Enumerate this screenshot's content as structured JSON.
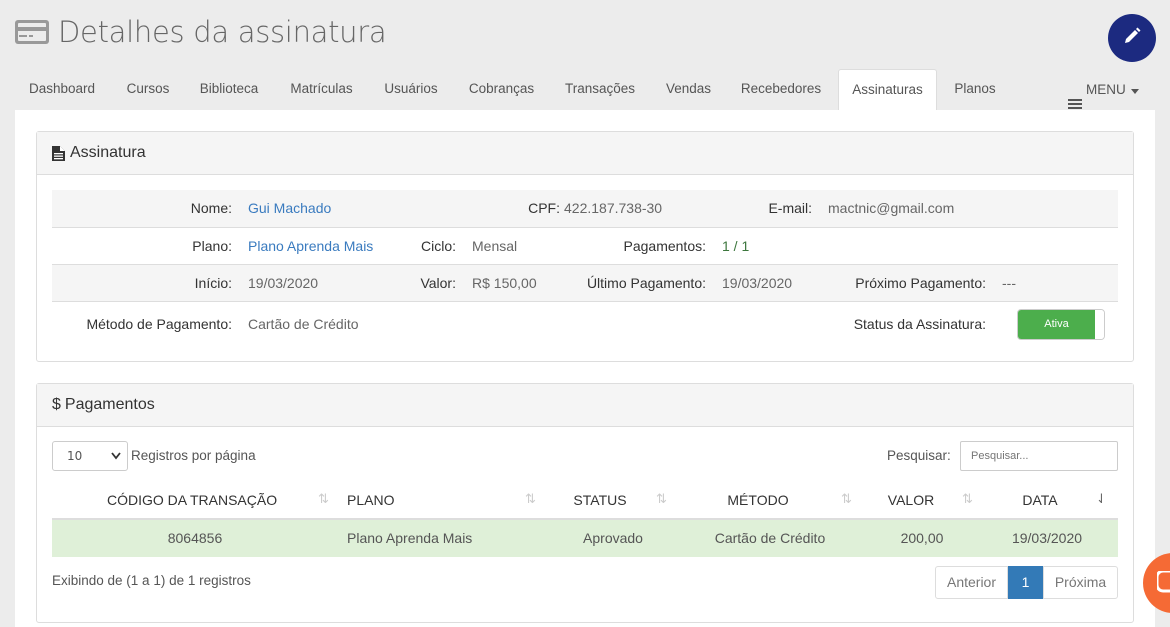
{
  "header": {
    "title": "Detalhes da assinatura"
  },
  "nav": {
    "tabs": [
      {
        "label": "Dashboard"
      },
      {
        "label": "Cursos"
      },
      {
        "label": "Biblioteca"
      },
      {
        "label": "Matrículas"
      },
      {
        "label": "Usuários"
      },
      {
        "label": "Cobranças"
      },
      {
        "label": "Transações"
      },
      {
        "label": "Vendas"
      },
      {
        "label": "Recebedores"
      },
      {
        "label": "Assinaturas"
      },
      {
        "label": "Planos"
      }
    ],
    "active_tab": "Assinaturas",
    "menu_label": "MENU"
  },
  "subscription": {
    "heading": "Assinatura",
    "nome_label": "Nome:",
    "nome": "Gui Machado",
    "cpf_label": "CPF:",
    "cpf": "422.187.738-30",
    "email_label": "E-mail:",
    "email": "mactnic@gmail.com",
    "plano_label": "Plano:",
    "plano": "Plano Aprenda Mais",
    "ciclo_label": "Ciclo:",
    "ciclo": "Mensal",
    "pagamentos_label": "Pagamentos:",
    "pagamentos": "1 / 1",
    "inicio_label": "Início:",
    "inicio": "19/03/2020",
    "valor_label": "Valor:",
    "valor": "R$ 150,00",
    "ultimo_label": "Último Pagamento:",
    "ultimo": "19/03/2020",
    "proximo_label": "Próximo Pagamento:",
    "proximo": "---",
    "metodo_label": "Método de Pagamento:",
    "metodo": "Cartão de Crédito",
    "status_label": "Status da Assinatura:",
    "status_toggle": "Ativa"
  },
  "payments": {
    "heading": "Pagamentos",
    "page_size": "10",
    "page_size_label": "Registros por página",
    "search_label": "Pesquisar:",
    "search_placeholder": "Pesquisar...",
    "columns": [
      "CÓDIGO DA TRANSAÇÃO",
      "PLANO",
      "STATUS",
      "MÉTODO",
      "VALOR",
      "DATA"
    ],
    "rows": [
      {
        "codigo": "8064856",
        "plano": "Plano Aprenda Mais",
        "status": "Aprovado",
        "metodo": "Cartão de Crédito",
        "valor": "200,00",
        "data": "19/03/2020"
      }
    ],
    "summary": "Exibindo de (1 a 1) de 1 registros",
    "pagination": {
      "prev": "Anterior",
      "current": "1",
      "next": "Próxima"
    }
  },
  "colors": {
    "fab": "#1c2a80",
    "toggle_on": "#4cae4c",
    "row_success": "#dff0d8",
    "page_active": "#337ab7",
    "chat": "#f56a35"
  }
}
